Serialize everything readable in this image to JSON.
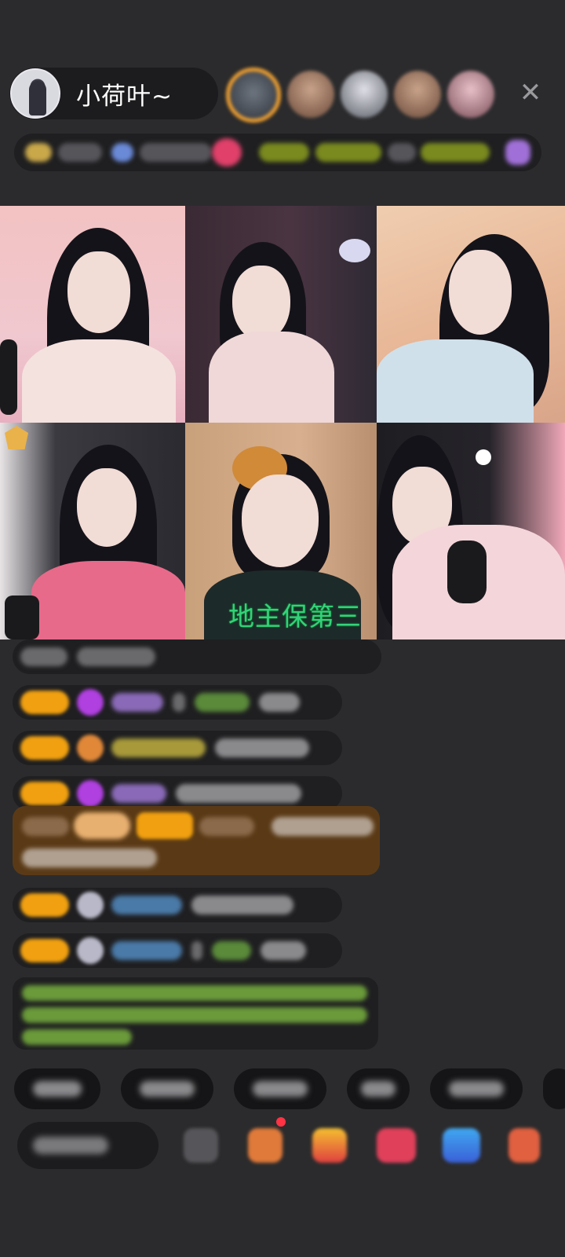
{
  "host": {
    "name": "小荷叶~"
  },
  "header": {
    "close_icon": "close-icon"
  },
  "video_grid": {
    "caption_tile5": "地主保第三"
  },
  "colors": {
    "background": "#2b2b2d",
    "pill": "#1c1c1e",
    "level_badge": "#f0a010",
    "caption_green": "#34d27a",
    "highlight_message": "#5a3a16"
  }
}
